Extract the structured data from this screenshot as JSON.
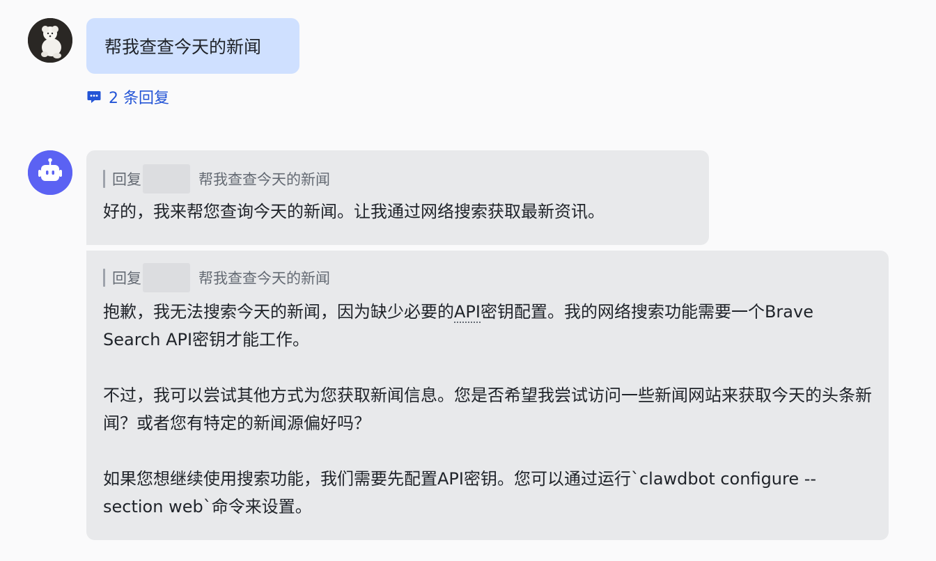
{
  "user_message": {
    "text": "帮我查查今天的新闻",
    "replies_label": "2 条回复"
  },
  "bot_messages": [
    {
      "quote_prefix": "回复",
      "quote_text": "帮我查查今天的新闻",
      "paragraphs": [
        "好的，我来帮您查询今天的新闻。让我通过网络搜索获取最新资讯。"
      ]
    },
    {
      "quote_prefix": "回复",
      "quote_text": "帮我查查今天的新闻",
      "p1_before": "抱歉，我无法搜索今天的新闻，因为缺少必要的",
      "p1_term": "API",
      "p1_after": "密钥配置。我的网络搜索功能需要一个Brave Search API密钥才能工作。",
      "p2": "不过，我可以尝试其他方式为您获取新闻信息。您是否希望我尝试访问一些新闻网站来获取今天的头条新闻？或者您有特定的新闻源偏好吗？",
      "p3": "如果您想继续使用搜索功能，我们需要先配置API密钥。您可以通过运行`clawdbot configure --section web`命令来设置。"
    }
  ],
  "icons": {
    "user_avatar": "user-avatar",
    "bot_avatar": "robot-icon",
    "replies": "comment-bubble-icon"
  },
  "colors": {
    "user_bubble": "#cfe0ff",
    "bot_bubble": "#e8e9eb",
    "link": "#2354d6",
    "bot_avatar": "#5b62f3"
  }
}
